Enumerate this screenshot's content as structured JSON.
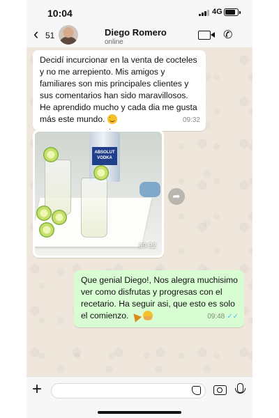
{
  "status_bar": {
    "time": "10:04",
    "network": "4G"
  },
  "header": {
    "back_count": "51",
    "contact_name": "Diego Romero",
    "presence": "online"
  },
  "messages": [
    {
      "direction": "incoming",
      "text": "Decidí incurcionar en la venta de cocteles y no me arrepiento. Mis amigos y familiares son mis principales clientes y sus comentarios han sido maravillosos. He aprendido mucho y cada dia me gusta más este mundo.",
      "emoji": "smile-emoji",
      "time": "09:32"
    },
    {
      "direction": "incoming",
      "type": "image",
      "image_label": "ABSOLUT VODKA",
      "time": "09:32"
    },
    {
      "direction": "outgoing",
      "text": "Que genial Diego!, Nos alegra muchisimo ver como disfrutas y progresas con el recetario. Ha seguir asi, que esto es solo el comienzo.",
      "emojis": [
        "party-popper-emoji",
        "hugging-face-emoji"
      ],
      "time": "09:48",
      "read": true
    }
  ],
  "colors": {
    "incoming_bubble": "#ffffff",
    "outgoing_bubble": "#d9fdd3",
    "read_ticks": "#53bdeb",
    "wallpaper": "#efe7dc"
  },
  "icons": [
    "back-chevron-icon",
    "video-call-icon",
    "phone-call-icon",
    "forward-icon",
    "plus-icon",
    "sticker-icon",
    "camera-icon",
    "microphone-icon"
  ]
}
